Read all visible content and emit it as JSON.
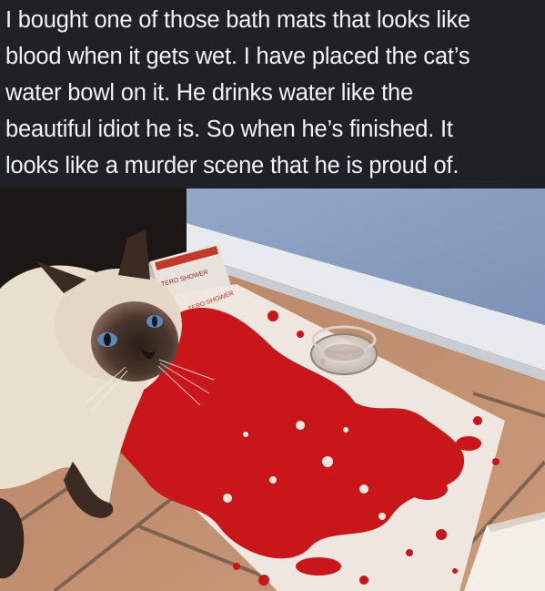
{
  "caption": {
    "text": "I bought one of those bath mats that looks like\nblood when it gets wet. I have placed the cat’s\nwater bowl on it. He drinks water like the\nbeautiful idiot he is. So when he’s finished. It\nlooks like a murder scene that he is proud of."
  },
  "photo": {
    "box_label": "TERO SHOWER",
    "mat_label": "TERO SHOWER",
    "colors": {
      "wall": "#8fa3c4",
      "baseboard": "#e9ecef",
      "floor_tile": "#c48f6e",
      "grout": "#6e5a4c",
      "mat": "#efe7e2",
      "blood": "#c9161b",
      "cat_cream": "#ede3d2",
      "cat_point": "#3a2a22",
      "cat_eye": "#5f86b8"
    }
  }
}
